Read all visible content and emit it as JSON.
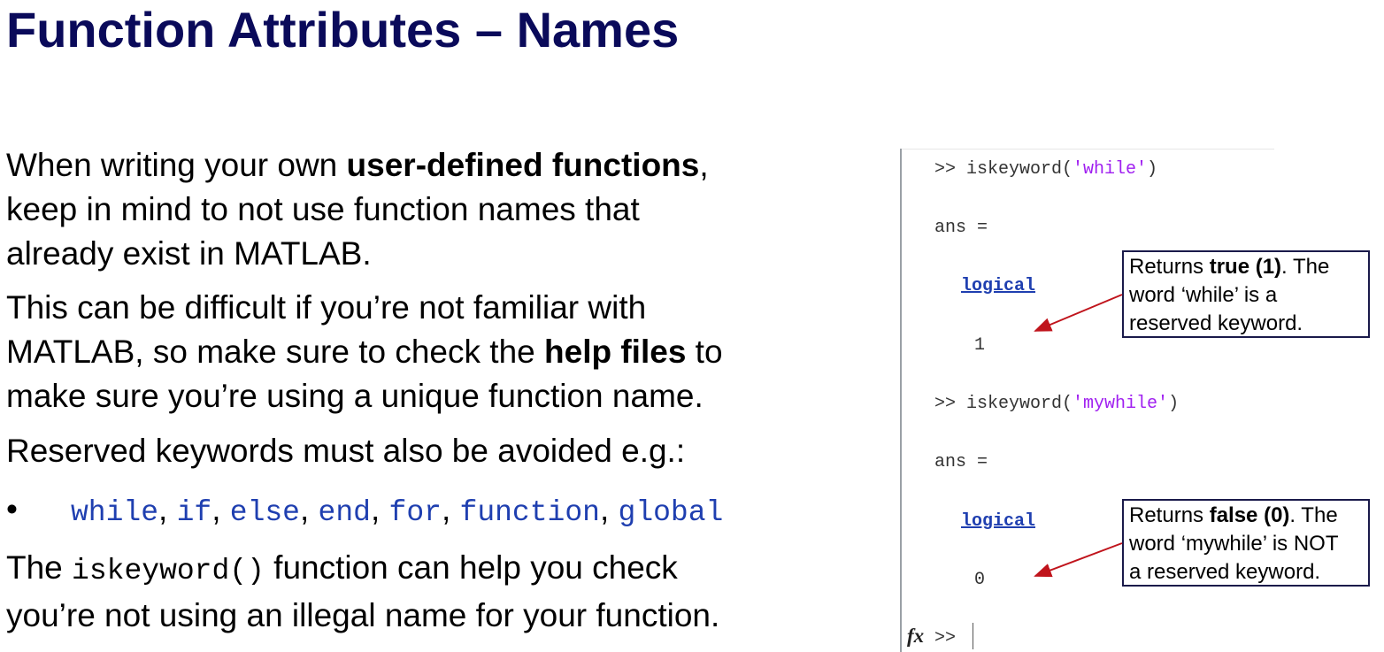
{
  "title": "Function Attributes – Names",
  "para1": {
    "pre": "When writing your own ",
    "bold": "user-defined functions",
    "post": ",",
    "line2": "keep in mind to not use function names that",
    "line3": "already exist in MATLAB."
  },
  "para2": {
    "line1": "This can be difficult if you’re not familiar with",
    "pre": "MATLAB, so make sure to check the ",
    "bold": "help files",
    "post": " to",
    "line3": "make sure you’re using a unique function name."
  },
  "para3": "Reserved keywords must also be avoided e.g.:",
  "bullet": {
    "marker": "•",
    "keywords": [
      "while",
      "if",
      "else",
      "end",
      "for",
      "function",
      "global"
    ],
    "separator": ", "
  },
  "para4": {
    "pre": "The ",
    "code": "iskeyword()",
    "post": " function can help you check",
    "line2": "you’re not using an illegal name for your function."
  },
  "console": {
    "cmd1": {
      "prompt": ">> iskeyword(",
      "arg": "'while'",
      "close": ")"
    },
    "ans1": "ans =",
    "type1": "logical",
    "val1": "1",
    "cmd2": {
      "prompt": ">> iskeyword(",
      "arg": "'mywhile'",
      "close": ")"
    },
    "ans2": "ans =",
    "type2": "logical",
    "val2": "0",
    "fx": "fx",
    "prompt": ">>"
  },
  "callout1": {
    "pre": "Returns ",
    "bold": "true (1)",
    "post": ". The",
    "line2": "word ‘while’ is a",
    "line3": "reserved keyword."
  },
  "callout2": {
    "pre": "Returns ",
    "bold": "false (0)",
    "post": ". The",
    "line2": "word ‘mywhile’ is NOT",
    "line3": "a reserved keyword."
  },
  "colors": {
    "title": "#0a0a5a",
    "code_blue": "#1f3fb0",
    "string_purple": "#a020f0",
    "arrow_red": "#c0141c"
  }
}
